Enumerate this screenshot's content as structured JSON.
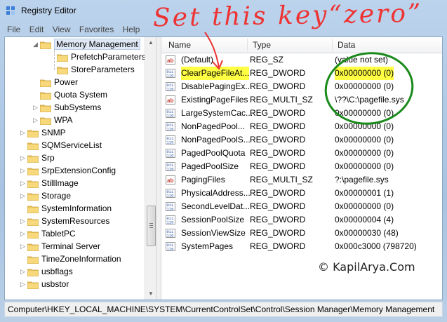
{
  "window": {
    "title": "Registry Editor",
    "menu": [
      "File",
      "Edit",
      "View",
      "Favorites",
      "Help"
    ]
  },
  "tree": {
    "items": [
      {
        "label": "Memory Management",
        "level": 2,
        "expanded": true,
        "selected": true
      },
      {
        "label": "PrefetchParameters",
        "level": 3
      },
      {
        "label": "StoreParameters",
        "level": 3
      },
      {
        "label": "Power",
        "level": 2
      },
      {
        "label": "Quota System",
        "level": 2
      },
      {
        "label": "SubSystems",
        "level": 2,
        "expandable": true
      },
      {
        "label": "WPA",
        "level": 2,
        "expandable": true
      },
      {
        "label": "SNMP",
        "level": 1,
        "expandable": true
      },
      {
        "label": "SQMServiceList",
        "level": 1
      },
      {
        "label": "Srp",
        "level": 1,
        "expandable": true
      },
      {
        "label": "SrpExtensionConfig",
        "level": 1,
        "expandable": true
      },
      {
        "label": "StillImage",
        "level": 1,
        "expandable": true
      },
      {
        "label": "Storage",
        "level": 1,
        "expandable": true
      },
      {
        "label": "SystemInformation",
        "level": 1
      },
      {
        "label": "SystemResources",
        "level": 1,
        "expandable": true
      },
      {
        "label": "TabletPC",
        "level": 1,
        "expandable": true
      },
      {
        "label": "Terminal Server",
        "level": 1,
        "expandable": true
      },
      {
        "label": "TimeZoneInformation",
        "level": 1
      },
      {
        "label": "usbflags",
        "level": 1,
        "expandable": true
      },
      {
        "label": "usbstor",
        "level": 1,
        "expandable": true
      }
    ]
  },
  "list": {
    "columns": {
      "name": "Name",
      "type": "Type",
      "data": "Data"
    },
    "rows": [
      {
        "name": "(Default)",
        "type": "REG_SZ",
        "data": "(value not set)",
        "icon": "string-value-icon"
      },
      {
        "name": "ClearPageFileAt...",
        "type": "REG_DWORD",
        "data": "0x00000000 (0)",
        "icon": "binary-value-icon",
        "highlight": true
      },
      {
        "name": "DisablePagingEx...",
        "type": "REG_DWORD",
        "data": "0x00000000 (0)",
        "icon": "binary-value-icon"
      },
      {
        "name": "ExistingPageFiles",
        "type": "REG_MULTI_SZ",
        "data": "\\??\\C:\\pagefile.sys",
        "icon": "string-value-icon"
      },
      {
        "name": "LargeSystemCac...",
        "type": "REG_DWORD",
        "data": "0x00000000 (0)",
        "icon": "binary-value-icon"
      },
      {
        "name": "NonPagedPool...",
        "type": "REG_DWORD",
        "data": "0x00000000 (0)",
        "icon": "binary-value-icon"
      },
      {
        "name": "NonPagedPoolS...",
        "type": "REG_DWORD",
        "data": "0x00000000 (0)",
        "icon": "binary-value-icon"
      },
      {
        "name": "PagedPoolQuota",
        "type": "REG_DWORD",
        "data": "0x00000000 (0)",
        "icon": "binary-value-icon"
      },
      {
        "name": "PagedPoolSize",
        "type": "REG_DWORD",
        "data": "0x00000000 (0)",
        "icon": "binary-value-icon"
      },
      {
        "name": "PagingFiles",
        "type": "REG_MULTI_SZ",
        "data": "?:\\pagefile.sys",
        "icon": "string-value-icon"
      },
      {
        "name": "PhysicalAddress...",
        "type": "REG_DWORD",
        "data": "0x00000001 (1)",
        "icon": "binary-value-icon"
      },
      {
        "name": "SecondLevelDat...",
        "type": "REG_DWORD",
        "data": "0x00000000 (0)",
        "icon": "binary-value-icon"
      },
      {
        "name": "SessionPoolSize",
        "type": "REG_DWORD",
        "data": "0x00000004 (4)",
        "icon": "binary-value-icon"
      },
      {
        "name": "SessionViewSize",
        "type": "REG_DWORD",
        "data": "0x00000030 (48)",
        "icon": "binary-value-icon"
      },
      {
        "name": "SystemPages",
        "type": "REG_DWORD",
        "data": "0x000c3000 (798720)",
        "icon": "binary-value-icon"
      }
    ]
  },
  "status": {
    "path": "Computer\\HKEY_LOCAL_MACHINE\\SYSTEM\\CurrentControlSet\\Control\\Session Manager\\Memory Management"
  },
  "annotation": {
    "text": "Set this key“zero”",
    "color": "#e53333",
    "circle_color": "#1a8a1a",
    "highlight_color": "#ffff44"
  },
  "watermark": "© KapilArya.Com"
}
